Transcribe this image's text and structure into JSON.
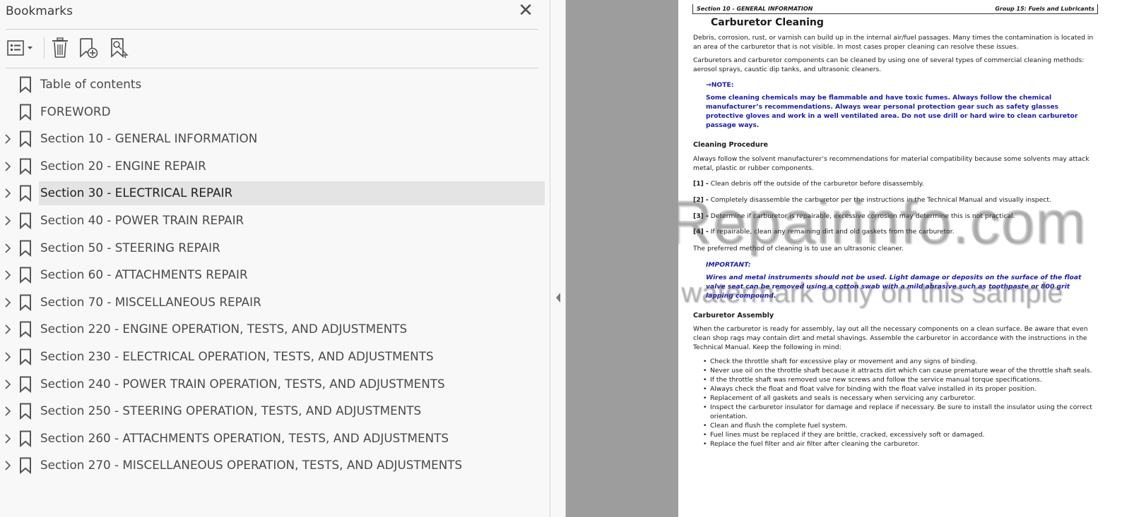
{
  "bookmarks_panel": {
    "title": "Bookmarks",
    "close_glyph": "✕",
    "toolbar": {
      "options_icon": "list-options-icon",
      "delete_icon": "trash-icon",
      "new_bookmark_icon": "add-bookmark-icon",
      "search_bookmark_icon": "find-bookmark-icon"
    },
    "items": [
      {
        "label": "Table of contents",
        "expandable": false,
        "selected": false
      },
      {
        "label": "FOREWORD",
        "expandable": false,
        "selected": false
      },
      {
        "label": "Section 10 - GENERAL INFORMATION",
        "expandable": true,
        "selected": false
      },
      {
        "label": "Section 20 - ENGINE REPAIR",
        "expandable": true,
        "selected": false
      },
      {
        "label": "Section 30 - ELECTRICAL REPAIR",
        "expandable": true,
        "selected": true
      },
      {
        "label": "Section 40 - POWER TRAIN REPAIR",
        "expandable": true,
        "selected": false
      },
      {
        "label": "Section 50 - STEERING REPAIR",
        "expandable": true,
        "selected": false
      },
      {
        "label": "Section 60 - ATTACHMENTS REPAIR",
        "expandable": true,
        "selected": false
      },
      {
        "label": "Section 70 - MISCELLANEOUS REPAIR",
        "expandable": true,
        "selected": false
      },
      {
        "label": "Section 220 - ENGINE OPERATION, TESTS, AND ADJUSTMENTS",
        "expandable": true,
        "selected": false
      },
      {
        "label": "Section 230 - ELECTRICAL OPERATION, TESTS, AND ADJUSTMENTS",
        "expandable": true,
        "selected": false
      },
      {
        "label": "Section 240 - POWER TRAIN OPERATION, TESTS, AND ADJUSTMENTS",
        "expandable": true,
        "selected": false
      },
      {
        "label": "Section 250 - STEERING OPERATION, TESTS, AND ADJUSTMENTS",
        "expandable": true,
        "selected": false
      },
      {
        "label": "Section 260 - ATTACHMENTS OPERATION, TESTS, AND ADJUSTMENTS",
        "expandable": true,
        "selected": false
      },
      {
        "label": "Section 270 - MISCELLANEOUS OPERATION, TESTS, AND ADJUSTMENTS",
        "expandable": true,
        "selected": false
      }
    ]
  },
  "document": {
    "header_left": "Section 10 - GENERAL INFORMATION",
    "header_right": "Group 15: Fuels and Lubricants",
    "title": "Carburetor Cleaning",
    "intro_1": "Debris, corrosion, rust, or varnish can build up in the internal air/fuel passages. Many times the contamination is located in an area of the carburetor that is not visible. In most cases proper cleaning can resolve these issues.",
    "intro_2": "Carburetors and carburetor components can be cleaned by using one of several types of commercial cleaning methods: aerosol sprays, caustic dip tanks, and ultrasonic cleaners.",
    "note_label": "→NOTE:",
    "note_text": "Some cleaning chemicals may be flammable and have toxic fumes. Always follow the chemical manufacturer’s recommendations. Always wear personal protection gear such as safety glasses protective gloves and work in a well ventilated area. Do not use drill or hard wire to clean carburetor passage ways.",
    "procedure_heading": "Cleaning Procedure",
    "procedure_intro": "Always follow the solvent manufacturer’s recommendations for material compatibility because some solvents may attack metal, plastic or rubber components.",
    "steps": [
      {
        "num": "[1] -",
        "text": " Clean debris off the outside of the carburetor before disassembly."
      },
      {
        "num": "[2] -",
        "text": " Completely disassemble the carburetor per the instructions in the Technical Manual and visually inspect."
      },
      {
        "num": "[3] -",
        "text": " Determine if carburetor is repairable, excessive corrosion may determine this is not practical."
      },
      {
        "num": "[4] -",
        "text": " If repairable, clean any remaining dirt and old gaskets from the carburetor."
      }
    ],
    "preferred_method": "The preferred method of cleaning is to use an ultrasonic cleaner.",
    "important_label": "IMPORTANT:",
    "important_text": "Wires and metal instruments should not be used. Light damage or deposits on the surface of the float valve seat can be removed using a cotton swab with a mild abrasive such as toothpaste or 800 grit lapping compound.",
    "assembly_heading": "Carburetor Assembly",
    "assembly_intro": "When the carburetor is ready for assembly, lay out all the necessary components on a clean surface. Be aware that even clean shop rags may contain dirt and metal shavings. Assemble the carburetor in accordance with the instructions in the Technical Manual. Keep the following in mind:",
    "bullets": [
      "Check the throttle shaft for excessive play or movement and any signs of binding.",
      "Never use oil on the throttle shaft because it attracts dirt which can cause premature wear of the throttle shaft seals.",
      "If the throttle shaft was removed use new screws and follow the service manual torque specifications.",
      "Always check the float and float valve for binding with the float valve installed in its proper position.",
      "Replacement of all gaskets and seals is necessary when servicing any carburetor.",
      "Inspect the carburetor insulator for damage and replace if necessary. Be sure to install the insulator using the correct orientation.",
      "Clean and flush the complete fuel system.",
      "Fuel lines must be replaced if they are brittle, cracked, excessively soft or damaged.",
      "Replace the fuel filter and air filter after cleaning the carburetor."
    ],
    "watermark_main": "eRepairinfo.com",
    "watermark_sub": "watermark only on this sample"
  }
}
